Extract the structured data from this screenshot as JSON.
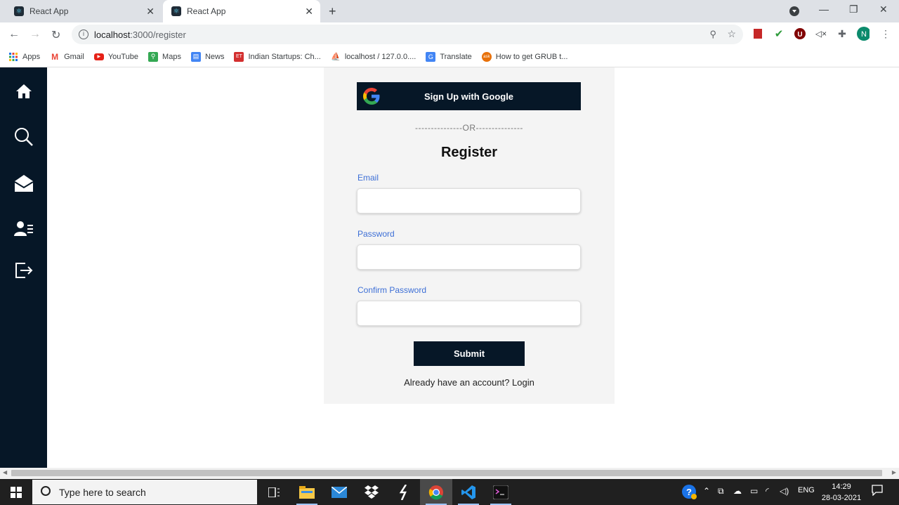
{
  "browser": {
    "tabs": [
      {
        "title": "React App",
        "active": false
      },
      {
        "title": "React App",
        "active": true
      }
    ],
    "url_host": "localhost",
    "url_path": ":3000/register",
    "profile_initial": "N",
    "bookmarks": [
      {
        "label": "Apps",
        "icon": "apps-grid-icon"
      },
      {
        "label": "Gmail",
        "icon": "gmail-icon"
      },
      {
        "label": "YouTube",
        "icon": "youtube-icon"
      },
      {
        "label": "Maps",
        "icon": "maps-icon"
      },
      {
        "label": "News",
        "icon": "news-icon"
      },
      {
        "label": "Indian Startups: Ch...",
        "icon": "et-icon"
      },
      {
        "label": "localhost / 127.0.0....",
        "icon": "phpmyadmin-icon"
      },
      {
        "label": "Translate",
        "icon": "translate-icon"
      },
      {
        "label": "How to get GRUB t...",
        "icon": "ask-icon"
      }
    ]
  },
  "sidebar": {
    "items": [
      {
        "icon": "home-icon"
      },
      {
        "icon": "search-icon"
      },
      {
        "icon": "mail-icon"
      },
      {
        "icon": "users-icon"
      },
      {
        "icon": "logout-icon"
      }
    ]
  },
  "register": {
    "google_button": "Sign Up with Google",
    "or_divider": "---------------OR---------------",
    "title": "Register",
    "email_label": "Email",
    "password_label": "Password",
    "confirm_label": "Confirm Password",
    "submit_label": "Submit",
    "footer_text": "Already have an account? Login"
  },
  "taskbar": {
    "search_placeholder": "Type here to search",
    "language": "ENG",
    "time": "14:29",
    "date": "28-03-2021"
  },
  "colors": {
    "sidebar_bg": "#061727",
    "accent_label": "#3d6fd6",
    "panel_bg": "#f4f4f4"
  }
}
